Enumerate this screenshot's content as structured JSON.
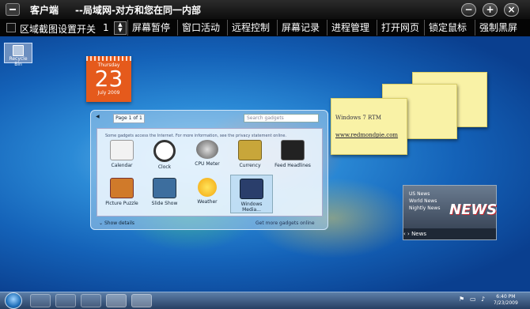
{
  "window": {
    "title": "客户端",
    "subtitle": "--局域网-对方和您在同一内部",
    "controls": [
      "−",
      "+",
      "×"
    ]
  },
  "toolbar": {
    "checkbox_label": "区域截图设置开关",
    "spin_value": "1",
    "buttons": [
      "屏幕暂停",
      "窗口活动",
      "远程控制",
      "屏幕记录",
      "进程管理",
      "打开网页",
      "锁定鼠标",
      "强制黑屏"
    ]
  },
  "desktop": {
    "recycle_bin_label": "Recycle Bin",
    "calendar": {
      "weekday": "Thursday",
      "day": "23",
      "month_year": "July 2009"
    },
    "sticky_note": {
      "line1": "Windows 7 RTM",
      "line2": "www.redmondpie.com"
    },
    "gadget_gallery": {
      "page_label": "Page 1 of 1",
      "search_placeholder": "Search gadgets",
      "info_text": "Some gadgets access the Internet. For more information, see the privacy statement online.",
      "gadgets": [
        "Calendar",
        "Clock",
        "CPU Meter",
        "Currency",
        "Feed Headlines",
        "Picture Puzzle",
        "Slide Show",
        "Weather",
        "Windows Media..."
      ],
      "show_details": "Show details",
      "get_more": "Get more gadgets online"
    },
    "news_gadget": {
      "items": [
        "US News",
        "World News",
        "Nightly News"
      ],
      "logo": "NEWS",
      "bar_label": "News"
    }
  },
  "taskbar": {
    "time": "6:40 PM",
    "date": "7/23/2009"
  },
  "icons": {
    "app": "app-menu-icon",
    "start": "windows-start-icon",
    "recycle": "recycle-bin-icon"
  }
}
